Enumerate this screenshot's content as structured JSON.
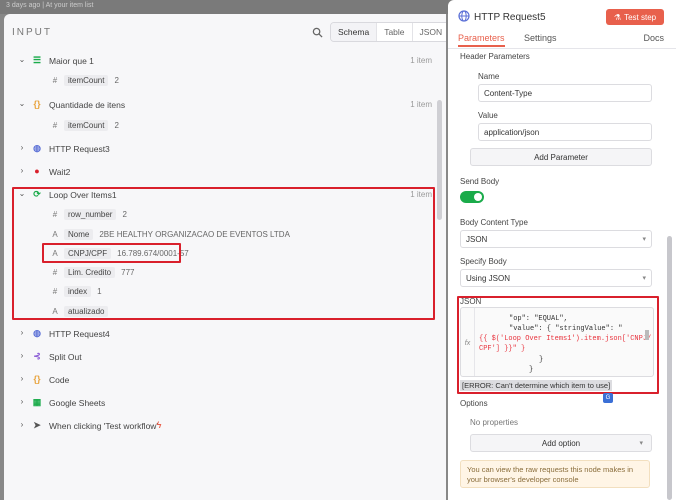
{
  "header_strip": {
    "text": "3 days ago  |  At your item list"
  },
  "input": {
    "title": "INPUT",
    "views": [
      "Schema",
      "Table",
      "JSON"
    ],
    "nodes": [
      {
        "label": "Maior que 1",
        "count": "1 item",
        "fields": [
          {
            "type": "#",
            "key": "itemCount",
            "value": "2"
          }
        ]
      },
      {
        "label": "Quantidade de itens",
        "count": "1 item",
        "fields": [
          {
            "type": "#",
            "key": "itemCount",
            "value": "2"
          }
        ]
      },
      {
        "label": "HTTP Request3"
      },
      {
        "label": "Wait2"
      },
      {
        "label": "Loop Over Items1",
        "count": "1 item",
        "fields": [
          {
            "type": "#",
            "key": "row_number",
            "value": "2"
          },
          {
            "type": "A",
            "key": "Nome",
            "value": "2BE HEALTHY ORGANIZACAO DE EVENTOS LTDA"
          },
          {
            "type": "A",
            "key": "CNPJ/CPF",
            "value": "16.789.674/0001-57"
          },
          {
            "type": "#",
            "key": "Lim. Credito",
            "value": "777"
          },
          {
            "type": "#",
            "key": "index",
            "value": "1"
          },
          {
            "type": "A",
            "key": "atualizado",
            "value": ""
          }
        ]
      },
      {
        "label": "HTTP Request4"
      },
      {
        "label": "Split Out"
      },
      {
        "label": "Code"
      },
      {
        "label": "Google Sheets"
      },
      {
        "label": "When clicking 'Test workflow'"
      }
    ]
  },
  "panel": {
    "title": "HTTP Request5",
    "test_button": "Test step",
    "tabs": [
      "Parameters",
      "Settings"
    ],
    "docs": "Docs",
    "header_params": "Header Parameters",
    "name_label": "Name",
    "name_value": "Content-Type",
    "value_label": "Value",
    "value_value": "application/json",
    "add_parameter": "Add Parameter",
    "send_body": "Send Body",
    "body_content_type_label": "Body Content Type",
    "body_content_type": "JSON",
    "specify_body_label": "Specify Body",
    "specify_body": "Using JSON",
    "json_label": "JSON",
    "json_lines": [
      "\"op\": \"EQUAL\",",
      "\"value\": { \"stringValue\": \"",
      "{{ $('Loop Over Items1').item.json['CNPJ/",
      "CPF'] }}\" }",
      "}",
      "}"
    ],
    "error": "[ERROR: Can't determine which item to use]",
    "options_label": "Options",
    "no_properties": "No properties",
    "add_option": "Add option",
    "note": "You can view the raw requests this node makes in your browser's developer console"
  },
  "colors": {
    "accent": "#e8604c",
    "highlight": "#d9202c",
    "toggle": "#1aab4a"
  }
}
